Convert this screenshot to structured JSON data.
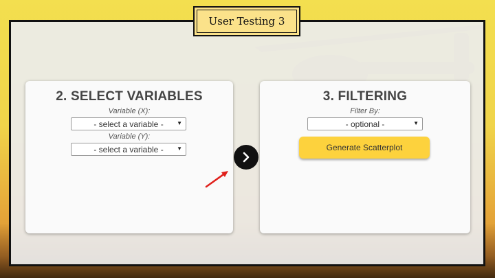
{
  "slide": {
    "title": "User Testing 3"
  },
  "step2": {
    "heading": "2. SELECT VARIABLES",
    "x_label": "Variable (X):",
    "x_value": "- select a variable -",
    "y_label": "Variable (Y):",
    "y_value": "- select a variable -"
  },
  "step3": {
    "heading": "3. FILTERING",
    "filter_label": "Filter By:",
    "filter_value": "- optional -",
    "generate_label": "Generate Scatterplot"
  },
  "icons": {
    "caret": "▼",
    "next": "chevron-right-icon",
    "annotation": "red-arrow-icon"
  },
  "colors": {
    "button_yellow": "#fdd23d",
    "annotation_red": "#e0201b",
    "next_button": "#111111"
  }
}
